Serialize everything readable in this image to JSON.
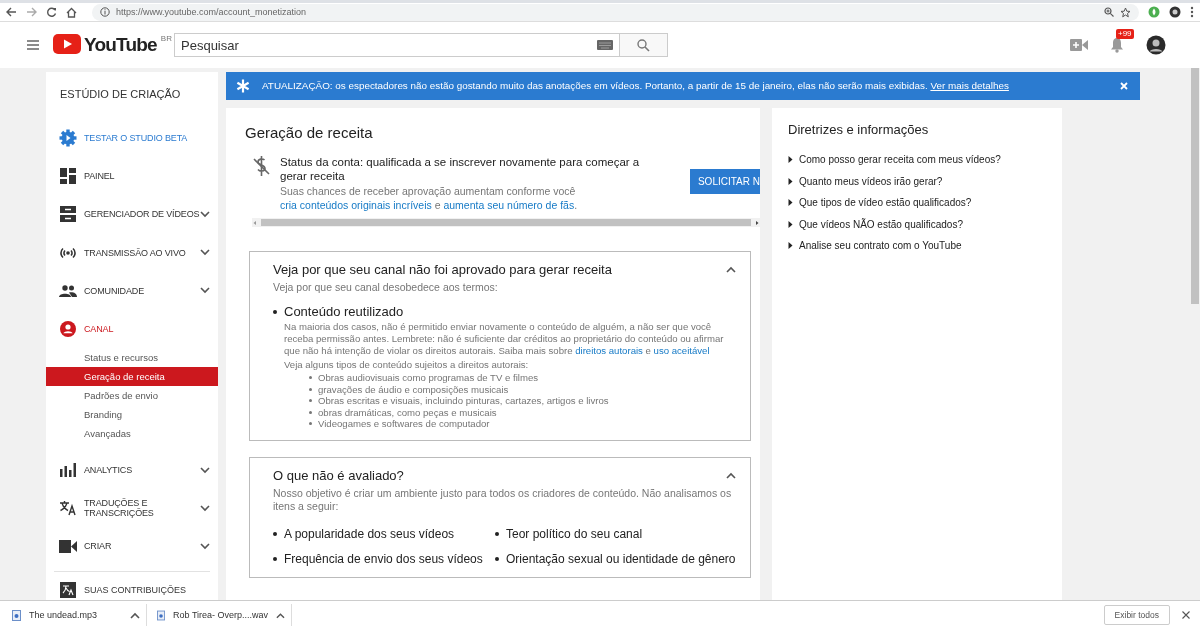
{
  "browser": {
    "url": "https://www.youtube.com/account_monetization"
  },
  "header": {
    "logo": "YouTube",
    "region": "BR",
    "search": {
      "placeholder": "Pesquisar"
    },
    "notifications": "+99"
  },
  "sidebar": {
    "title": "ESTÚDIO DE CRIAÇÃO",
    "items": [
      {
        "label": "TESTAR O STUDIO BETA",
        "kind": "beta",
        "selected": false,
        "expandable": false
      },
      {
        "label": "PAINEL",
        "kind": "section",
        "selected": false,
        "expandable": false
      },
      {
        "label": "GERENCIADOR DE VÍDEOS",
        "kind": "section",
        "selected": false,
        "expandable": true
      },
      {
        "label": "TRANSMISSÃO AO VIVO",
        "kind": "section",
        "selected": false,
        "expandable": true
      },
      {
        "label": "COMUNIDADE",
        "kind": "section",
        "selected": false,
        "expandable": true
      },
      {
        "label": "CANAL",
        "kind": "section",
        "selected": true,
        "expandable": false,
        "children": [
          {
            "label": "Status e recursos",
            "selected": false
          },
          {
            "label": "Geração de receita",
            "selected": true
          },
          {
            "label": "Padrões de envio",
            "selected": false
          },
          {
            "label": "Branding",
            "selected": false
          },
          {
            "label": "Avançadas",
            "selected": false
          }
        ]
      },
      {
        "label": "ANALYTICS",
        "kind": "section",
        "selected": false,
        "expandable": true
      },
      {
        "label": "TRADUÇÕES E TRANSCRIÇÕES",
        "kind": "section",
        "selected": false,
        "expandable": true
      },
      {
        "label": "CRIAR",
        "kind": "section",
        "selected": false,
        "expandable": true
      }
    ],
    "footer_item": {
      "label": "SUAS CONTRIBUIÇÕES"
    }
  },
  "banner": {
    "text": "ATUALIZAÇÃO: os espectadores não estão gostando muito das anotações em vídeos. Portanto, a partir de 15 de janeiro, elas não serão mais exibidas.",
    "link": "Ver mais detalhes"
  },
  "main": {
    "title": "Geração de receita",
    "status": {
      "title": "Status da conta: qualificada a se inscrever novamente para começar a gerar receita",
      "description": [
        {
          "text": "Suas chances de receber aprovação aumentam conforme você "
        },
        {
          "link": "cria conteúdos originais incríveis"
        },
        {
          "text": " e "
        },
        {
          "link": "aumenta seu número de fãs"
        },
        {
          "text": "."
        }
      ],
      "button": "SOLICITAR N"
    },
    "sections": [
      {
        "kind": "issues",
        "title": "Veja por que seu canal não foi aprovado para gerar receita",
        "subtitle": "Veja por que seu canal desobedece aos termos:",
        "expanded": true,
        "issue": {
          "title": "Conteúdo reutilizado",
          "body": [
            {
              "text": "Na maioria dos casos, não é permitido enviar novamente o conteúdo de alguém, a não ser que você receba permissão antes. Lembrete: não é suficiente dar créditos ao proprietário do conteúdo ou afirmar que não há intenção de violar os direitos autorais. Saiba mais sobre "
            },
            {
              "link": "direitos autorais"
            },
            {
              "text": " e "
            },
            {
              "link": "uso aceitável"
            }
          ],
          "list_intro": "Veja alguns tipos de conteúdo sujeitos a direitos autorais:",
          "examples": [
            "Obras audiovisuais como programas de TV e filmes",
            "gravações de áudio e composições musicais",
            "Obras escritas e visuais, incluindo pinturas, cartazes, artigos e livros",
            "obras dramáticas, como peças e musicais",
            "Videogames e softwares de computador"
          ]
        }
      },
      {
        "kind": "columns",
        "title": "O que não é avaliado?",
        "subtitle": "Nosso objetivo é criar um ambiente justo para todos os criadores de conteúdo. Não analisamos os itens a seguir:",
        "expanded": true,
        "items": [
          "A popularidade dos seus vídeos",
          "Teor político do seu canal",
          "Frequência de envio dos seus vídeos",
          "Orientação sexual ou identidade de gênero"
        ]
      }
    ]
  },
  "guide": {
    "title": "Diretrizes e informações",
    "items": [
      {
        "label": "Como posso gerar receita com meus vídeos?",
        "expanded": false
      },
      {
        "label": "Quanto meus vídeos irão gerar?",
        "expanded": false
      },
      {
        "label": "Que tipos de vídeo estão qualificados?",
        "expanded": false
      },
      {
        "label": "Que vídeos NÃO estão qualificados?",
        "expanded": false
      },
      {
        "label": "Analise seu contrato com o YouTube",
        "expanded": false
      }
    ]
  },
  "downloads": {
    "items": [
      {
        "name": "The undead.mp3"
      },
      {
        "name": "Rob Tirea- Overp....wav"
      }
    ],
    "button": "Exibir todos"
  }
}
